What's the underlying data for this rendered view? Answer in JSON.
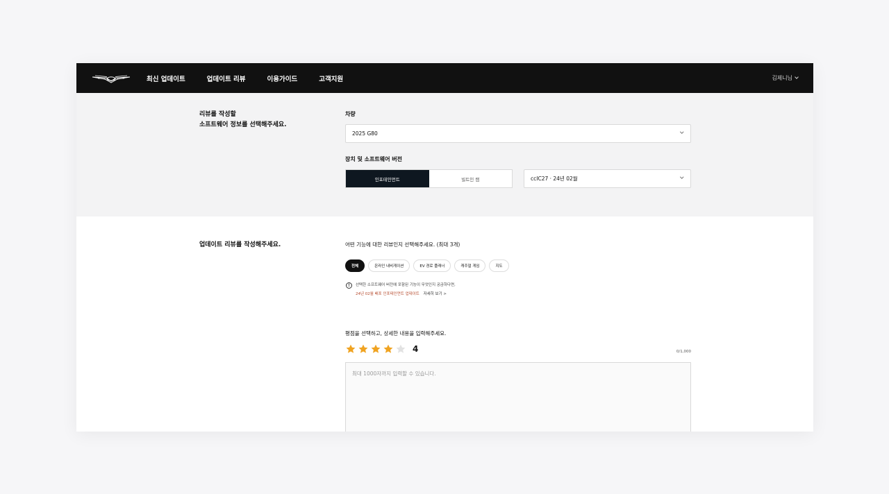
{
  "nav": {
    "logo_alt": "Genesis",
    "items": [
      "최신 업데이트",
      "업데이트 리뷰",
      "이용가이드",
      "고객지원"
    ],
    "user": "김제니님"
  },
  "vehicle_section": {
    "title_line1": "리뷰를 작성할",
    "title_line2": "소프트웨어 정보를 선택해주세요.",
    "vehicle_label": "차량",
    "vehicle_value": "2025 G80",
    "device_label": "장치 및 소프트웨어 버전",
    "device_options": [
      "인포테인먼트",
      "빌트인 캠"
    ],
    "device_selected": 0,
    "version_value": "ccIC27 · 24년 02월"
  },
  "review_section": {
    "title": "업데이트 리뷰를 작성해주세요.",
    "feature_prompt": "어떤 기능에 대한 리뷰인지 선택해주세요. (최대 3개)",
    "chips": [
      "전체",
      "온라인 내비게이션",
      "EV 경로 플래너",
      "캐주얼 게임",
      "지도"
    ],
    "chip_selected": 0,
    "info_text": "선택한 소프트웨어 버전에 포함된 기능이 무엇인지 궁금하다면,",
    "info_link": "24년 02월 배포 인포테인먼트 업데이트",
    "info_more": "자세히 보기 >",
    "rating_prompt": "평점을 선택하고, 상세한 내용을 입력해주세요.",
    "rating": 4,
    "rating_max": 5,
    "rating_label": "4",
    "char_counter": "0/1,000",
    "placeholder": "최대 1000자까지 입력할 수 있습니다."
  },
  "colors": {
    "nav_bg": "#111111",
    "segment_active": "#0e1720",
    "star_on": "#f0a321",
    "star_off": "#e2e2e2",
    "accent_link": "#b5482a"
  }
}
